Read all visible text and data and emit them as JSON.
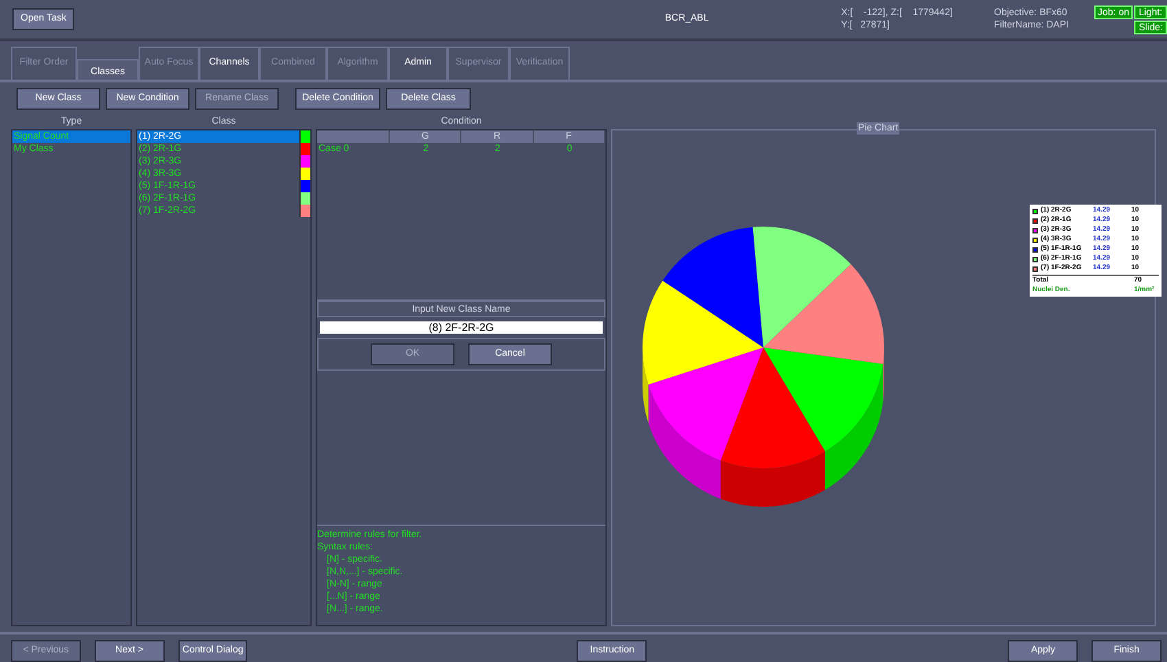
{
  "header": {
    "open_button": "Open Task",
    "title": "BCR_ABL",
    "coords": [
      "X:[    -122], Z:[    1779442]",
      "Y:[   27871]"
    ],
    "objective": [
      "Objective: BFx60",
      "FilterName: DAPI"
    ],
    "badges": [
      {
        "label": "Job: on",
        "on": true
      },
      {
        "label": "Light:",
        "on": true
      },
      {
        "label": "Slide:",
        "on": true
      }
    ]
  },
  "tabs": [
    {
      "label": "Filter Order",
      "selected": false,
      "disabled": true
    },
    {
      "label": "Classes",
      "selected": true,
      "disabled": false
    },
    {
      "label": "Auto Focus",
      "selected": false,
      "disabled": true
    },
    {
      "label": "Channels",
      "selected": false,
      "disabled": false
    },
    {
      "label": "Combined",
      "selected": false,
      "disabled": true
    },
    {
      "label": "Algorithm",
      "selected": false,
      "disabled": true
    },
    {
      "label": "Admin",
      "selected": false,
      "disabled": false
    },
    {
      "label": "Supervisor",
      "selected": false,
      "disabled": true
    },
    {
      "label": "Verification",
      "selected": false,
      "disabled": true
    }
  ],
  "toolbar": [
    {
      "label": "New Class",
      "disabled": false
    },
    {
      "label": "New Condition",
      "disabled": false
    },
    {
      "label": "Rename Class",
      "disabled": true
    },
    {
      "label": "Delete Condition",
      "disabled": false
    },
    {
      "label": "Delete Class",
      "disabled": false
    }
  ],
  "type_panel": {
    "heading": "Type",
    "items": [
      {
        "label": "Signal Count",
        "selected": true
      },
      {
        "label": "My Class",
        "selected": false
      }
    ]
  },
  "class_panel": {
    "heading": "Class",
    "items": [
      {
        "label": "(1) 2R-2G",
        "color": "#00ff00",
        "selected": true
      },
      {
        "label": "(2) 2R-1G",
        "color": "#ff0000",
        "selected": false
      },
      {
        "label": "(3) 2R-3G",
        "color": "#ff00ff",
        "selected": false
      },
      {
        "label": "(4) 3R-3G",
        "color": "#ffff00",
        "selected": false
      },
      {
        "label": "(5) 1F-1R-1G",
        "color": "#0000ff",
        "selected": false
      },
      {
        "label": "(6) 2F-1R-1G",
        "color": "#80ff80",
        "selected": false
      },
      {
        "label": "(7) 1F-2R-2G",
        "color": "#ff8080",
        "selected": false
      }
    ]
  },
  "condition_panel": {
    "heading": "Condition",
    "columns": [
      "",
      "G",
      "R",
      "F"
    ],
    "rows": [
      [
        "Case 0",
        "2",
        "2",
        "0"
      ]
    ],
    "dialog": {
      "title": "Input New Class Name",
      "value": "(8) 2F-2R-2G",
      "buttons": [
        {
          "label": "OK",
          "disabled": true
        },
        {
          "label": "Cancel",
          "disabled": false
        }
      ]
    },
    "help": [
      "Determine rules for filter.",
      "Syntax rules:",
      "[N] - specific.",
      "[N,N,...] - specific.",
      "[N-N] - range",
      "[...N] - range",
      "[N...] - range."
    ]
  },
  "pie_panel": {
    "chart_data": {
      "type": "pie",
      "title": "Pie Chart",
      "categories": [
        "(1) 2R-2G",
        "(2) 2R-1G",
        "(3) 2R-3G",
        "(4) 3R-3G",
        "(5) 1F-1R-1G",
        "(6) 2F-1R-1G",
        "(7) 1F-2R-2G"
      ],
      "values": [
        14.29,
        14.29,
        14.29,
        14.29,
        14.29,
        14.29,
        14.29
      ]
    },
    "percents": [
      "14.29",
      "14.29",
      "14.29",
      "14.29",
      "14.29",
      "14.29",
      "14.29"
    ],
    "counts": [
      "10",
      "10",
      "10",
      "10",
      "10",
      "10",
      "10"
    ],
    "total_label": "Total",
    "total": "70",
    "density_label": "Nuclei Den.",
    "density": "1/mm²"
  },
  "footer": [
    {
      "label": "< Previous",
      "disabled": true
    },
    {
      "label": "Next >",
      "disabled": false
    },
    {
      "label": "Control Dialog",
      "disabled": false
    },
    {
      "label": "Instruction",
      "disabled": false
    },
    {
      "label": "Apply",
      "disabled": false
    },
    {
      "label": "Finish",
      "disabled": false
    }
  ]
}
